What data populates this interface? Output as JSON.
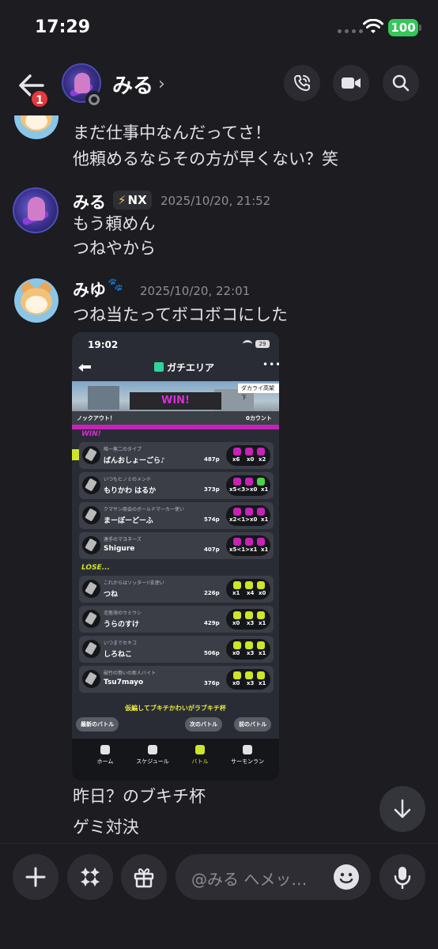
{
  "status_bar": {
    "time": "17:29",
    "battery": "100"
  },
  "header": {
    "back_badge": "1",
    "contact_name": "みる",
    "chevron": "›"
  },
  "messages": [
    {
      "lines": [
        "まだ仕事中なんだってさ！",
        "他頼めるならその方が早くない？笑"
      ]
    },
    {
      "author": "みる",
      "tag": "NX",
      "timestamp": "2025/10/20, 21:52",
      "lines": [
        "もう頼めん",
        "つねやから"
      ]
    },
    {
      "author": "みゆ",
      "timestamp": "2025/10/20, 22:01",
      "lines": [
        "つね当たってボコボコにした"
      ],
      "after_lines": [
        "昨日？のブキチ杯",
        "ゲミ対決"
      ]
    }
  ],
  "game_screenshot": {
    "time": "19:02",
    "battery": "29",
    "title": "ガチエリア",
    "stage": "ダカライ高架下",
    "result": "WIN!",
    "knockout": "ノックアウト！",
    "count": "0カウント",
    "win_label": "WIN!",
    "lose_label": "LOSE...",
    "win_players": [
      {
        "title": "唯一無二のタイプ",
        "name": "ばんおしょーごら♪",
        "points": "487p",
        "k": "x6",
        "d": "x0",
        "s": "x2"
      },
      {
        "title": "いつもヒノミのメンテ",
        "name": "もりかわ はるか",
        "points": "373p",
        "k": "x5<3>",
        "d": "x0",
        "s": "x1"
      },
      {
        "title": "クマサン商会のボールドマーカー使い",
        "name": "まーぽーどーふ",
        "points": "574p",
        "k": "x2<1>",
        "d": "x0",
        "s": "x1"
      },
      {
        "title": "達手のマヨネーズ",
        "name": "Shigure",
        "points": "407p",
        "k": "x5<1>",
        "d": "x1",
        "s": "x1"
      }
    ],
    "lose_players": [
      {
        "title": "これからはソッター!!玄使い",
        "name": "つね",
        "points": "226p",
        "k": "x1",
        "d": "x4",
        "s": "x0"
      },
      {
        "title": "北極海のウミウシ",
        "name": "うらのすけ",
        "points": "429p",
        "k": "x0",
        "d": "x3",
        "s": "x1"
      },
      {
        "title": "いつまでセキコ",
        "name": "しろねこ",
        "points": "506p",
        "k": "x0",
        "d": "x3",
        "s": "x1"
      },
      {
        "title": "破竹の勢いの新人バイト",
        "name": "Tsu7mayo",
        "points": "376p",
        "k": "x0",
        "d": "x3",
        "s": "x1"
      }
    ],
    "promo": "仮編してブキチかわいがラブキチ杯",
    "btn_latest": "最新のバトル",
    "btn_next": "次のバトル",
    "btn_prev": "前のバトル",
    "tabs": [
      "ホーム",
      "スケジュール",
      "バトル",
      "サーモンラン"
    ]
  },
  "composer": {
    "placeholder": "@みる へメッ…"
  },
  "colors": {
    "accent_win": "#c722b8",
    "lime": "#cde626",
    "online_badge": "#e6383d",
    "battery": "#34c759"
  },
  "icons": [
    "back-arrow-icon",
    "phone-icon",
    "video-icon",
    "search-icon",
    "plus-icon",
    "apps-icon",
    "gift-icon",
    "emoji-icon",
    "mic-icon",
    "arrow-down-icon"
  ]
}
